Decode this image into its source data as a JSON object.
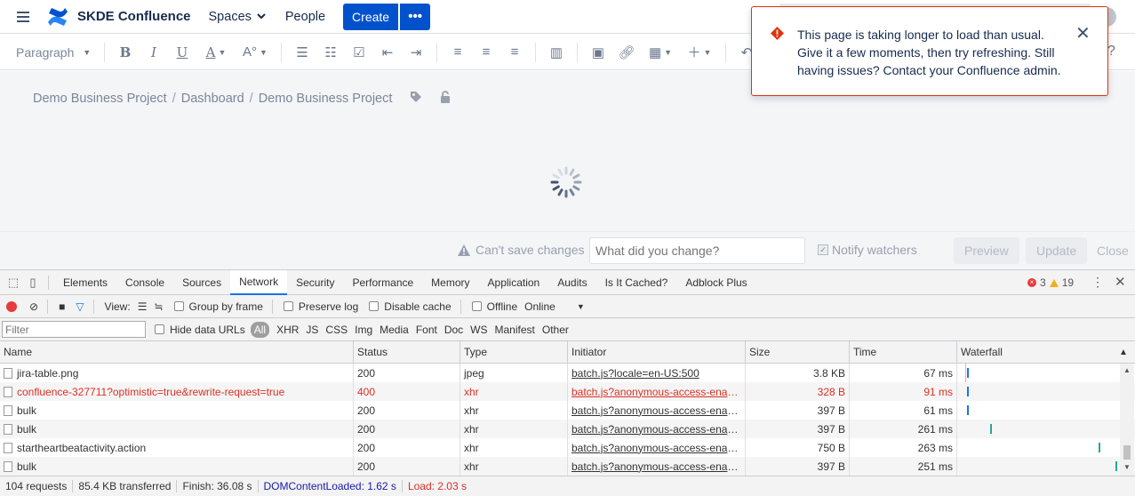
{
  "topnav": {
    "brand": "SKDE Confluence",
    "spaces_label": "Spaces",
    "people_label": "People",
    "create_label": "Create",
    "more_label": "•••"
  },
  "toolbar": {
    "paragraph_label": "Paragraph"
  },
  "breadcrumb": [
    "Demo Business Project",
    "Dashboard",
    "Demo Business Project"
  ],
  "savebar": {
    "warning": "Can't save changes",
    "change_placeholder": "What did you change?",
    "notify_label": "Notify watchers",
    "preview_label": "Preview",
    "update_label": "Update",
    "close_label": "Close"
  },
  "flag": {
    "message": "This page is taking longer to load than usual. Give it a few moments, then try refreshing. Still having issues? Contact your Confluence admin."
  },
  "devtools": {
    "tabs": [
      "Elements",
      "Console",
      "Sources",
      "Network",
      "Security",
      "Performance",
      "Memory",
      "Application",
      "Audits",
      "Is It Cached?",
      "Adblock Plus"
    ],
    "active_tab": "Network",
    "error_count": "3",
    "warning_count": "19",
    "view_label": "View:",
    "group_by_frame": "Group by frame",
    "preserve_log": "Preserve log",
    "disable_cache": "Disable cache",
    "offline": "Offline",
    "throttle": "Online",
    "filter_placeholder": "Filter",
    "hide_data_urls": "Hide data URLs",
    "filter_types": [
      "All",
      "XHR",
      "JS",
      "CSS",
      "Img",
      "Media",
      "Font",
      "Doc",
      "WS",
      "Manifest",
      "Other"
    ],
    "columns": [
      "Name",
      "Status",
      "Type",
      "Initiator",
      "Size",
      "Time",
      "Waterfall"
    ],
    "rows": [
      {
        "name": "jira-table.png",
        "status": "200",
        "type": "jpeg",
        "initiator": "batch.js?locale=en-US:500",
        "size": "3.8 KB",
        "time": "67 ms",
        "error": false
      },
      {
        "name": "confluence-327711?optimistic=true&rewrite-request=true",
        "status": "400",
        "type": "xhr",
        "initiator": "batch.js?anonymous-access-enabl...",
        "size": "328 B",
        "time": "91 ms",
        "error": true
      },
      {
        "name": "bulk",
        "status": "200",
        "type": "xhr",
        "initiator": "batch.js?anonymous-access-enabl...",
        "size": "397 B",
        "time": "61 ms",
        "error": false
      },
      {
        "name": "bulk",
        "status": "200",
        "type": "xhr",
        "initiator": "batch.js?anonymous-access-enabl...",
        "size": "397 B",
        "time": "261 ms",
        "error": false
      },
      {
        "name": "startheartbeatactivity.action",
        "status": "200",
        "type": "xhr",
        "initiator": "batch.js?anonymous-access-enabl...",
        "size": "750 B",
        "time": "263 ms",
        "error": false
      },
      {
        "name": "bulk",
        "status": "200",
        "type": "xhr",
        "initiator": "batch.js?anonymous-access-enabl...",
        "size": "397 B",
        "time": "251 ms",
        "error": false
      }
    ],
    "status": {
      "requests": "104 requests",
      "transferred": "85.4 KB transferred",
      "finish": "Finish: 36.08 s",
      "dom": "DOMContentLoaded: 1.62 s",
      "load": "Load: 2.03 s"
    }
  },
  "colors": {
    "brand_blue": "#0052cc",
    "error_red": "#de350b",
    "devtools_active": "#1a73e8"
  }
}
